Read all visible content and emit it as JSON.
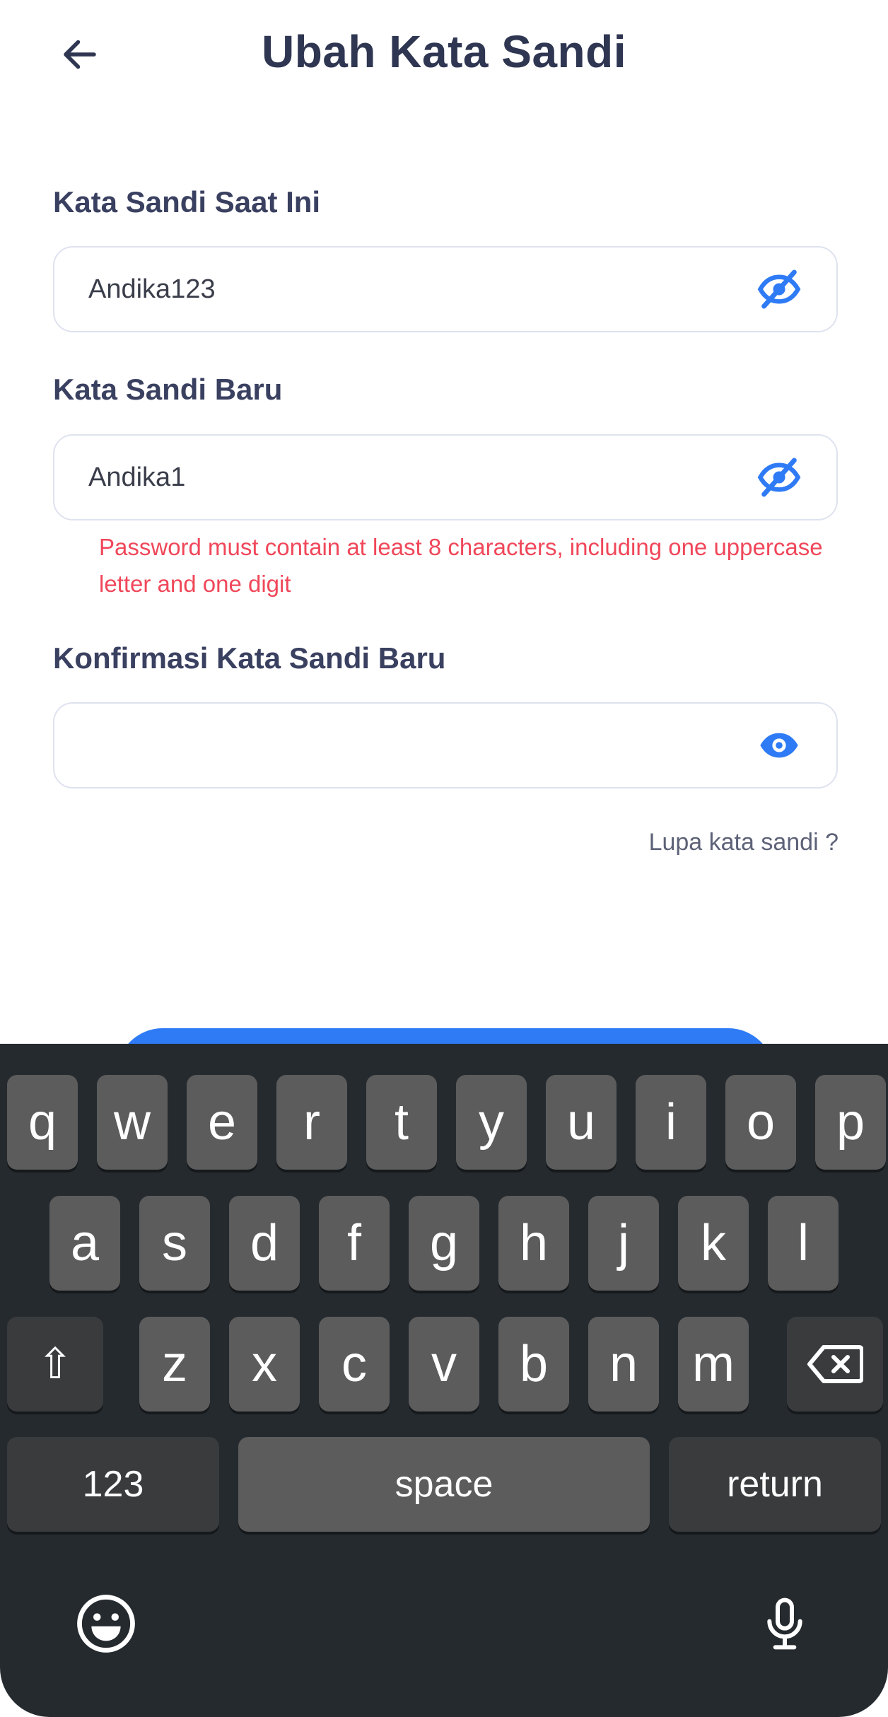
{
  "header": {
    "title": "Ubah Kata Sandi"
  },
  "form": {
    "current": {
      "label": "Kata Sandi Saat Ini",
      "value": "Andika123"
    },
    "new": {
      "label": "Kata Sandi Baru",
      "value": "Andika1",
      "error": "Password must contain at least 8 characters, including one uppercase letter and one digit"
    },
    "confirm": {
      "label": "Konfirmasi Kata Sandi Baru",
      "value": ""
    },
    "forgot_link": "Lupa kata sandi ?"
  },
  "keyboard": {
    "row1": [
      "q",
      "w",
      "e",
      "r",
      "t",
      "y",
      "u",
      "i",
      "o",
      "p"
    ],
    "row2": [
      "a",
      "s",
      "d",
      "f",
      "g",
      "h",
      "j",
      "k",
      "l"
    ],
    "row3": [
      "z",
      "x",
      "c",
      "v",
      "b",
      "n",
      "m"
    ],
    "numbers_label": "123",
    "space_label": "space",
    "return_label": "return",
    "shift_glyph": "⇧"
  },
  "colors": {
    "accent": "#2f7bf6",
    "error": "#f0475a",
    "title": "#2f3652",
    "keyboard_bg": "#252a2f"
  },
  "icons": [
    "back-arrow-icon",
    "eye-off-icon",
    "eye-icon",
    "shift-icon",
    "backspace-icon",
    "emoji-icon",
    "microphone-icon"
  ]
}
